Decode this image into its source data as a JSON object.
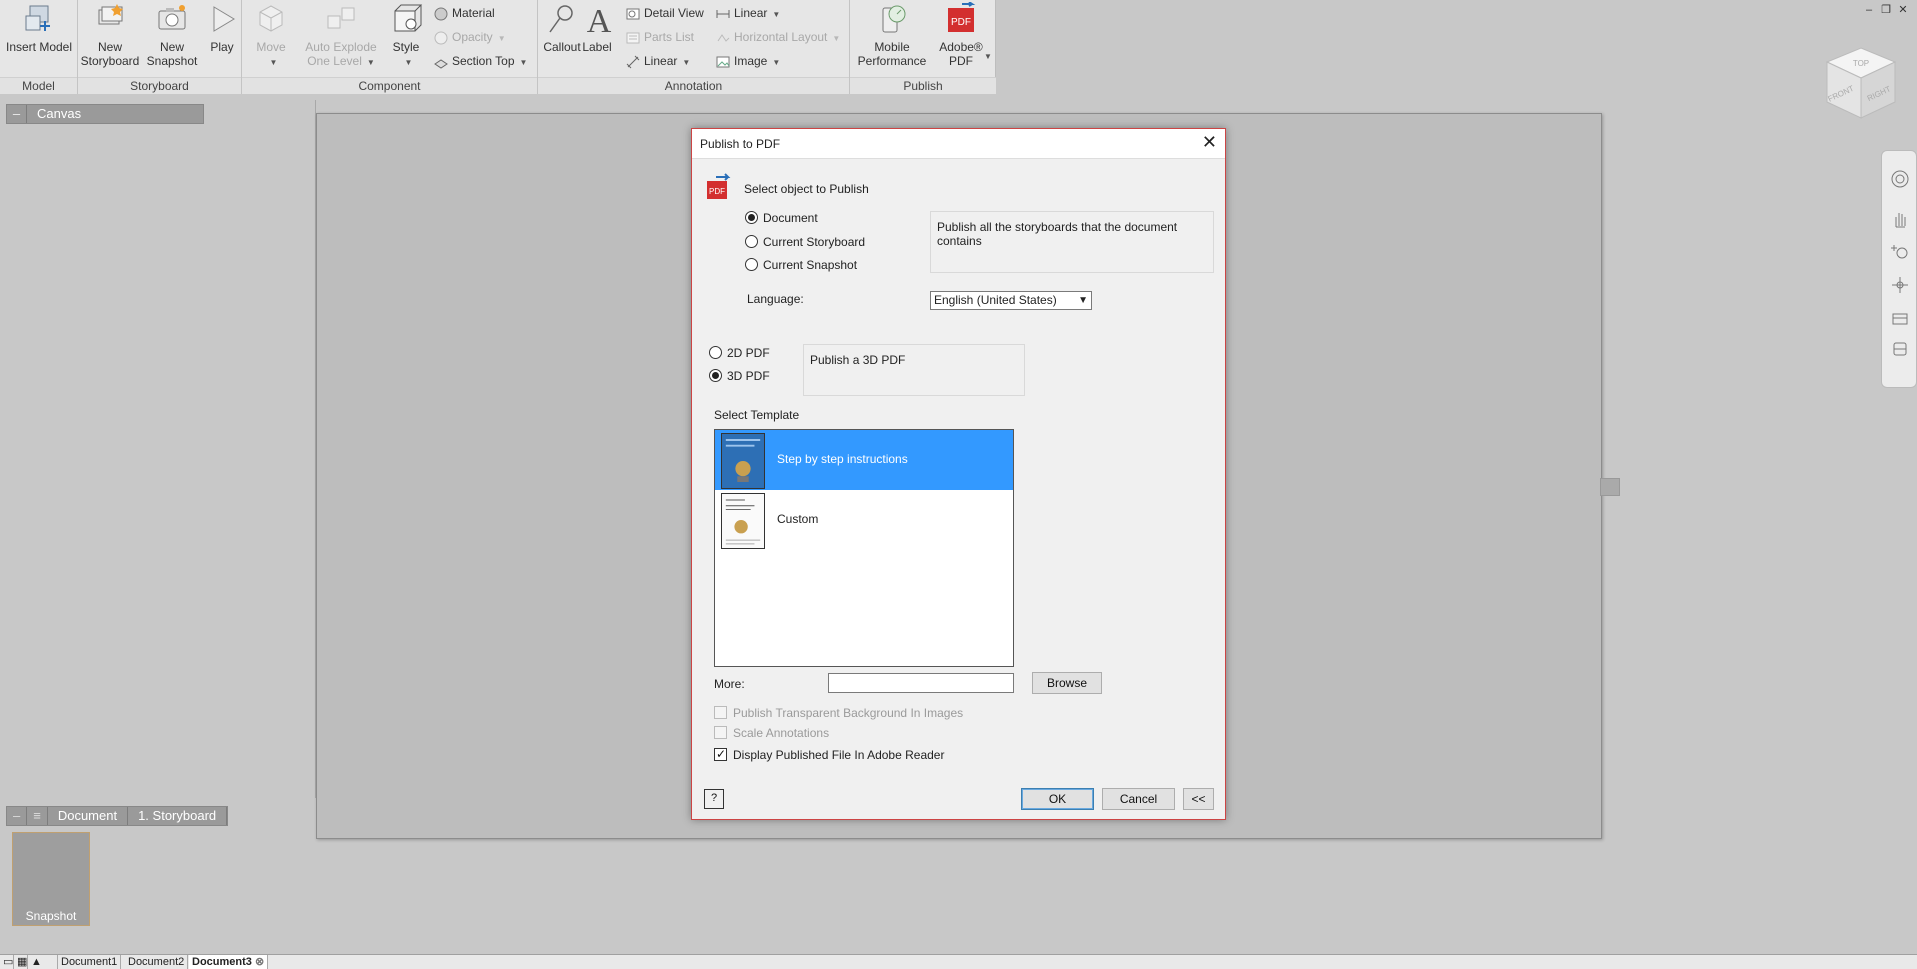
{
  "ribbon": {
    "groups": {
      "model": "Model",
      "storyboard": "Storyboard",
      "component": "Component",
      "annotation": "Annotation",
      "publish": "Publish"
    },
    "buttons": {
      "insert_model": "Insert Model",
      "new_storyboard_1": "New",
      "new_storyboard_2": "Storyboard",
      "new_snapshot_1": "New",
      "new_snapshot_2": "Snapshot",
      "play": "Play",
      "move": "Move",
      "auto_explode_1": "Auto Explode",
      "auto_explode_2": "One Level",
      "style": "Style",
      "material": "Material",
      "opacity": "Opacity",
      "section_top": "Section Top",
      "callout": "Callout",
      "label": "Label",
      "detail_view": "Detail View",
      "parts_list": "Parts List",
      "linear_a": "Linear",
      "linear_b": "Linear",
      "horizontal_layout": "Horizontal Layout",
      "image": "Image",
      "mobile_perf_1": "Mobile",
      "mobile_perf_2": "Performance",
      "adobe_pdf_1": "Adobe®",
      "adobe_pdf_2": "PDF"
    }
  },
  "navcube": {
    "top": "TOP",
    "front": "FRONT",
    "right": "RIGHT"
  },
  "panels": {
    "canvas": "Canvas",
    "breadcrumb": [
      "Document",
      "1. Storyboard"
    ],
    "snapshot_label": "Snapshot"
  },
  "doc_tabs": [
    "Document1",
    "Document2",
    "Document3"
  ],
  "dialog": {
    "title": "Publish to PDF",
    "select_object_label": "Select object to Publish",
    "object_options": [
      "Document",
      "Current Storyboard",
      "Current Snapshot"
    ],
    "object_selected": "Document",
    "object_description": "Publish all the storyboards that the document contains",
    "language_label": "Language:",
    "language_value": "English (United States)",
    "pdf_options": [
      "2D PDF",
      "3D PDF"
    ],
    "pdf_selected": "3D PDF",
    "pdf_description": "Publish a 3D PDF",
    "template_label": "Select Template",
    "templates": [
      "Step by step instructions",
      "Custom"
    ],
    "template_selected": "Step by step instructions",
    "more_label": "More:",
    "more_value": "",
    "browse": "Browse",
    "checkboxes": [
      {
        "label": "Publish Transparent Background In Images",
        "checked": false,
        "disabled": true
      },
      {
        "label": "Scale Annotations",
        "checked": false,
        "disabled": true
      },
      {
        "label": "Display Published File In Adobe Reader",
        "checked": true,
        "disabled": false
      }
    ],
    "help": "?",
    "ok": "OK",
    "cancel": "Cancel",
    "collapse": "<<"
  },
  "colors": {
    "selection": "#3399ff",
    "dialog_border": "#cc4444",
    "pdf_red": "#d32f2f"
  }
}
